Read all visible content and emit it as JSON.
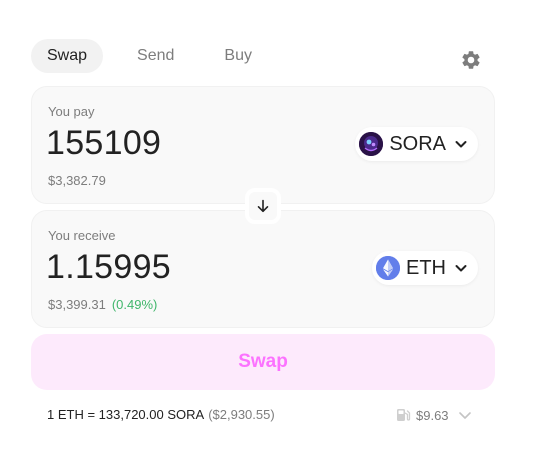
{
  "tabs": [
    {
      "label": "Swap",
      "active": true
    },
    {
      "label": "Send",
      "active": false
    },
    {
      "label": "Buy",
      "active": false
    }
  ],
  "settings_icon": "gear-icon",
  "pay": {
    "label": "You pay",
    "amount": "155109",
    "usd": "$3,382.79",
    "token": {
      "symbol": "SORA",
      "icon": "sora-token-icon"
    }
  },
  "switch_icon": "arrow-down-icon",
  "receive": {
    "label": "You receive",
    "amount": "1.15995",
    "usd": "$3,399.31",
    "price_impact": "(0.49%)",
    "token": {
      "symbol": "ETH",
      "icon": "eth-token-icon"
    }
  },
  "swap_button_label": "Swap",
  "rate": {
    "text": "1 ETH = 133,720.00 SORA",
    "usd": "($2,930.55)"
  },
  "gas": {
    "icon": "gas-pump-icon",
    "value": "$9.63"
  },
  "colors": {
    "accent": "#fc72ff",
    "accent_bg": "#fdeafc",
    "positive": "#40b66b",
    "muted": "#7d7d7d",
    "card_bg": "#f9f9f9"
  }
}
